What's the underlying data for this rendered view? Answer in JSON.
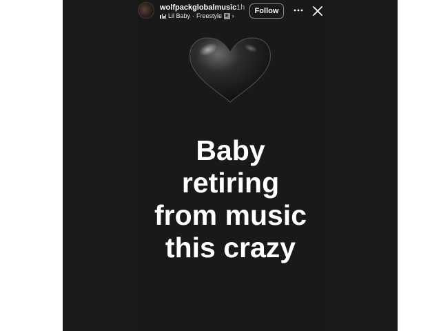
{
  "header": {
    "username": "wolfpackglobalmusic",
    "time_ago": "1h",
    "music": {
      "artist": "Lil Baby",
      "separator": "·",
      "track": "Freestyle",
      "explicit": "E",
      "chevron": "›"
    },
    "follow_label": "Follow",
    "more_icon": "more-horizontal-icon",
    "close_icon": "close-icon"
  },
  "sticker": {
    "emoji": "black-heart-icon",
    "color": "#1c1c1c"
  },
  "caption": {
    "lines": [
      "Baby",
      "retiring",
      "from music",
      "this crazy"
    ]
  },
  "colors": {
    "background": "#191919",
    "text": "#ffffff"
  }
}
